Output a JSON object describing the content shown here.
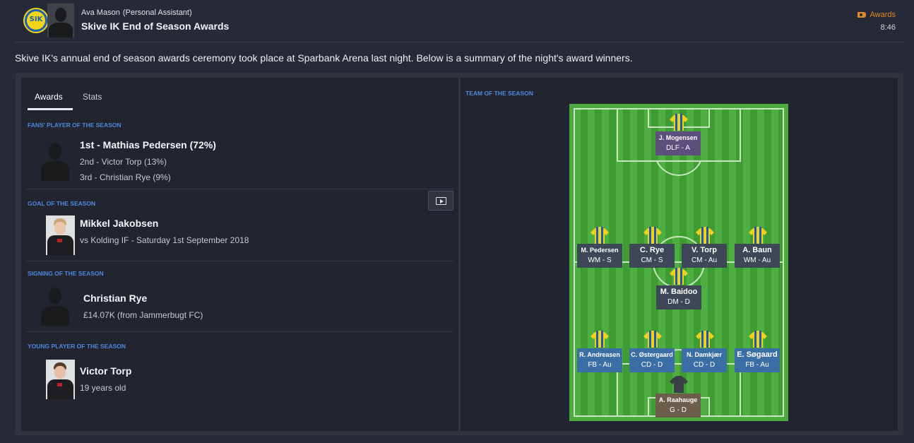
{
  "header": {
    "sender_name": "Ava Mason",
    "sender_role": "(Personal Assistant)",
    "subject": "Skive IK End of Season Awards",
    "tag_label": "Awards",
    "time": "8:46",
    "club_badge_text": "SIK",
    "colors": {
      "tag": "#e08a2a",
      "section_title": "#4f87dd"
    }
  },
  "summary": "Skive IK's annual end of season awards ceremony took place at Sparbank Arena last night. Below is a summary of the night's award winners.",
  "tabs": [
    {
      "label": "Awards",
      "active": true
    },
    {
      "label": "Stats",
      "active": false
    }
  ],
  "awards": {
    "fans": {
      "title": "FANS' PLAYER OF THE SEASON",
      "first": "1st - Mathias Pedersen (72%)",
      "second": "2nd - Victor Torp (13%)",
      "third": "3rd - Christian Rye (9%)"
    },
    "goal": {
      "title": "GOAL OF THE SEASON",
      "name": "Mikkel Jakobsen",
      "detail": "vs Kolding IF - Saturday 1st September 2018",
      "video_icon": "tv-play-icon"
    },
    "signing": {
      "title": "SIGNING OF THE SEASON",
      "name": "Christian Rye",
      "detail": "£14.07K (from Jammerbugt FC)"
    },
    "young": {
      "title": "YOUNG PLAYER OF THE SEASON",
      "name": "Victor Torp",
      "detail": "19 years old"
    }
  },
  "team_of_season": {
    "title": "TEAM OF THE SEASON",
    "players": [
      {
        "name": "J. Mogensen",
        "role": "DLF  -  A"
      },
      {
        "name": "M. Pedersen",
        "role": "WM   -  S"
      },
      {
        "name": "C. Rye",
        "role": "CM   -  S"
      },
      {
        "name": "V. Torp",
        "role": "CM  -  Au"
      },
      {
        "name": "A. Baun",
        "role": "WM  -  Au"
      },
      {
        "name": "M. Baidoo",
        "role": "DM   -  D"
      },
      {
        "name": "R. Andreasen",
        "role": "FB   -  Au"
      },
      {
        "name": "C. Østergaard",
        "role": "CD   -  D"
      },
      {
        "name": "N. Damkjær",
        "role": "CD   -  D"
      },
      {
        "name": "E. Søgaard",
        "role": "FB   -  Au"
      },
      {
        "name": "A. Raahauge",
        "role": "G   -  D"
      }
    ]
  }
}
